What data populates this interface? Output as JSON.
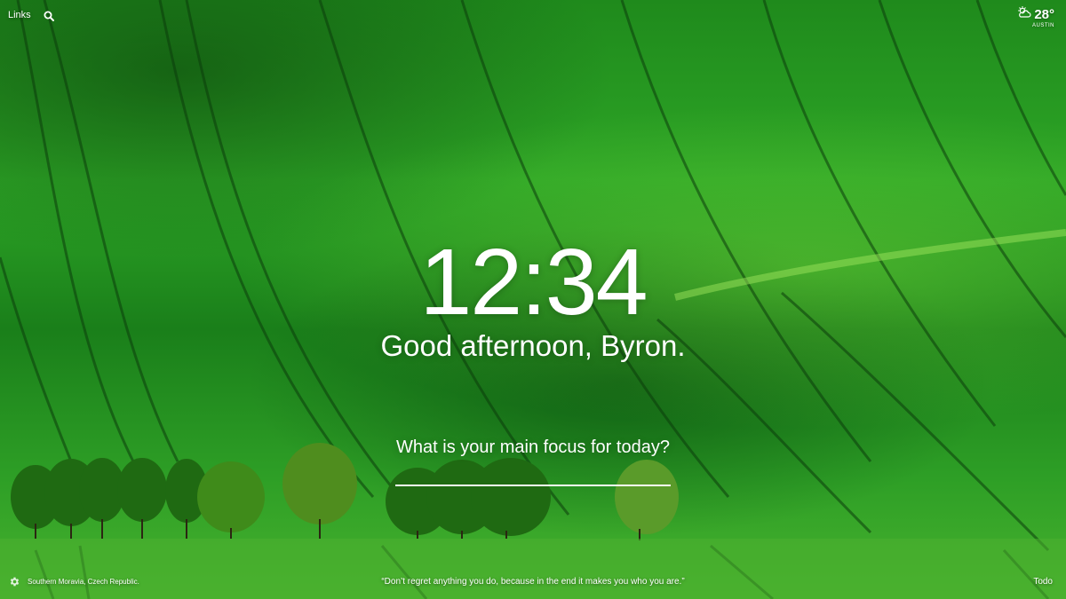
{
  "top_left": {
    "links_label": "Links",
    "search_icon": "search-icon"
  },
  "weather": {
    "icon": "partly-cloudy-icon",
    "temperature": "28°",
    "city": "AUSTIN"
  },
  "clock": {
    "time": "12:34"
  },
  "greeting": {
    "text": "Good afternoon, Byron."
  },
  "focus": {
    "question": "What is your main focus for today?",
    "value": ""
  },
  "footer": {
    "settings_icon": "gear-icon",
    "photo_location": "Southern Moravia, Czech Republic.",
    "quote": "“Don’t regret anything you do, because in the end it makes you who you are.”",
    "todo_label": "Todo"
  },
  "colors": {
    "text": "#ffffff",
    "field_green": "#2da526",
    "field_dark": "#1a7f1a"
  }
}
